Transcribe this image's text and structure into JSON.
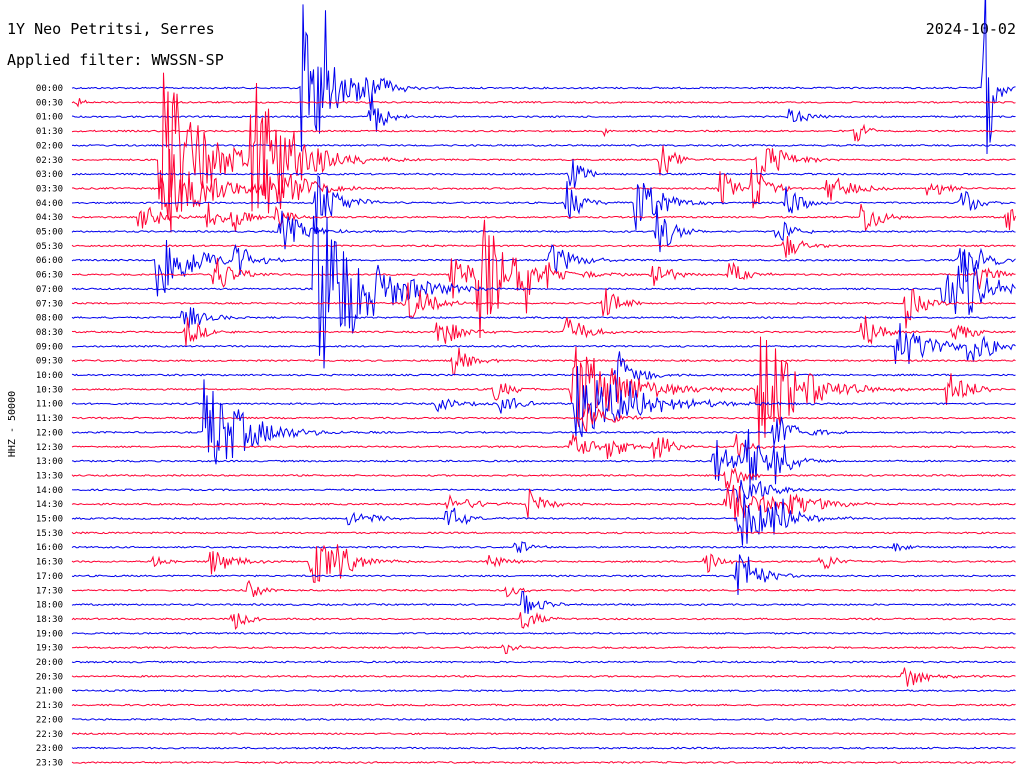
{
  "header": {
    "station": "1Y Neo Petritsi, Serres",
    "date": "2024-10-02",
    "filter": "Applied filter: WWSSN-SP"
  },
  "chart_data": {
    "type": "line",
    "title": "1Y Neo Petritsi, Serres",
    "ylabel": "HHZ - 50000",
    "row_labels": [
      "00:00",
      "00:30",
      "01:00",
      "01:30",
      "02:00",
      "02:30",
      "03:00",
      "03:30",
      "04:00",
      "04:30",
      "05:00",
      "05:30",
      "06:00",
      "06:30",
      "07:00",
      "07:30",
      "08:00",
      "08:30",
      "09:00",
      "09:30",
      "10:00",
      "10:30",
      "11:00",
      "11:30",
      "12:00",
      "12:30",
      "13:00",
      "13:30",
      "14:00",
      "14:30",
      "15:00",
      "15:30",
      "16:00",
      "16:30",
      "17:00",
      "17:30",
      "18:00",
      "18:30",
      "19:00",
      "19:30",
      "20:00",
      "20:30",
      "21:00",
      "21:30",
      "22:00",
      "22:30",
      "23:00",
      "23:30"
    ],
    "colors": [
      "#0000ee",
      "#ff0033"
    ],
    "x_range_minutes": [
      0,
      30
    ],
    "events": [
      {
        "row": 0,
        "minute": 7.9,
        "amp": 120,
        "dur": 0.5
      },
      {
        "row": 0,
        "minute": 7.3,
        "amp": 90,
        "dur": 1.5
      },
      {
        "row": 0,
        "minute": 8.0,
        "amp": 20,
        "dur": 1.2
      },
      {
        "row": 0,
        "minute": 9.0,
        "amp": 25,
        "dur": 1.5
      },
      {
        "row": 0,
        "minute": 9.2,
        "amp": 18,
        "dur": 1.2
      },
      {
        "row": 0,
        "minute": 29.0,
        "amp": 120,
        "dur": 0.5
      },
      {
        "row": 1,
        "minute": 0.2,
        "amp": 8,
        "dur": 0.3
      },
      {
        "row": 2,
        "minute": 9.5,
        "amp": 28,
        "dur": 0.8
      },
      {
        "row": 2,
        "minute": 22.8,
        "amp": 12,
        "dur": 1.0
      },
      {
        "row": 3,
        "minute": 24.9,
        "amp": 14,
        "dur": 0.8
      },
      {
        "row": 3,
        "minute": 16.9,
        "amp": 5,
        "dur": 0.3
      },
      {
        "row": 5,
        "minute": 2.8,
        "amp": 110,
        "dur": 2.5
      },
      {
        "row": 5,
        "minute": 5.7,
        "amp": 90,
        "dur": 2.5
      },
      {
        "row": 5,
        "minute": 21.8,
        "amp": 30,
        "dur": 1.5
      },
      {
        "row": 5,
        "minute": 18.7,
        "amp": 20,
        "dur": 1.0
      },
      {
        "row": 6,
        "minute": 15.8,
        "amp": 25,
        "dur": 0.8
      },
      {
        "row": 7,
        "minute": 2.9,
        "amp": 50,
        "dur": 2.5
      },
      {
        "row": 7,
        "minute": 6.1,
        "amp": 40,
        "dur": 2.0
      },
      {
        "row": 7,
        "minute": 20.6,
        "amp": 20,
        "dur": 1.0
      },
      {
        "row": 7,
        "minute": 21.6,
        "amp": 25,
        "dur": 1.0
      },
      {
        "row": 7,
        "minute": 24.0,
        "amp": 18,
        "dur": 1.5
      },
      {
        "row": 7,
        "minute": 27.2,
        "amp": 15,
        "dur": 1.0
      },
      {
        "row": 8,
        "minute": 7.7,
        "amp": 35,
        "dur": 1.5
      },
      {
        "row": 8,
        "minute": 15.7,
        "amp": 25,
        "dur": 1.0
      },
      {
        "row": 8,
        "minute": 17.9,
        "amp": 35,
        "dur": 1.5
      },
      {
        "row": 8,
        "minute": 18.5,
        "amp": 22,
        "dur": 0.8
      },
      {
        "row": 8,
        "minute": 22.7,
        "amp": 20,
        "dur": 1.0
      },
      {
        "row": 8,
        "minute": 28.2,
        "amp": 20,
        "dur": 1.0
      },
      {
        "row": 9,
        "minute": 2.1,
        "amp": 25,
        "dur": 1.2
      },
      {
        "row": 9,
        "minute": 4.3,
        "amp": 18,
        "dur": 0.8
      },
      {
        "row": 9,
        "minute": 5.1,
        "amp": 22,
        "dur": 0.8
      },
      {
        "row": 9,
        "minute": 6.5,
        "amp": 15,
        "dur": 0.8
      },
      {
        "row": 9,
        "minute": 25.1,
        "amp": 25,
        "dur": 1.0
      },
      {
        "row": 9,
        "minute": 29.7,
        "amp": 18,
        "dur": 0.8
      },
      {
        "row": 10,
        "minute": 6.6,
        "amp": 25,
        "dur": 1.5
      },
      {
        "row": 10,
        "minute": 18.6,
        "amp": 30,
        "dur": 1.0
      },
      {
        "row": 10,
        "minute": 22.3,
        "amp": 20,
        "dur": 1.0
      },
      {
        "row": 11,
        "minute": 22.6,
        "amp": 18,
        "dur": 1.0
      },
      {
        "row": 12,
        "minute": 2.7,
        "amp": 50,
        "dur": 2.0
      },
      {
        "row": 12,
        "minute": 5.2,
        "amp": 22,
        "dur": 1.2
      },
      {
        "row": 12,
        "minute": 15.2,
        "amp": 20,
        "dur": 1.5
      },
      {
        "row": 12,
        "minute": 28.2,
        "amp": 30,
        "dur": 1.5
      },
      {
        "row": 13,
        "minute": 4.5,
        "amp": 25,
        "dur": 1.2
      },
      {
        "row": 13,
        "minute": 12.0,
        "amp": 30,
        "dur": 1.5
      },
      {
        "row": 13,
        "minute": 12.9,
        "amp": 65,
        "dur": 2.5
      },
      {
        "row": 13,
        "minute": 14.4,
        "amp": 30,
        "dur": 1.0
      },
      {
        "row": 13,
        "minute": 18.4,
        "amp": 22,
        "dur": 1.0
      },
      {
        "row": 13,
        "minute": 20.9,
        "amp": 15,
        "dur": 1.0
      },
      {
        "row": 13,
        "minute": 28.8,
        "amp": 18,
        "dur": 1.0
      },
      {
        "row": 14,
        "minute": 7.7,
        "amp": 110,
        "dur": 3.0
      },
      {
        "row": 14,
        "minute": 27.7,
        "amp": 40,
        "dur": 2.0
      },
      {
        "row": 14,
        "minute": 28.3,
        "amp": 30,
        "dur": 1.5
      },
      {
        "row": 15,
        "minute": 10.6,
        "amp": 25,
        "dur": 1.5
      },
      {
        "row": 15,
        "minute": 16.9,
        "amp": 22,
        "dur": 1.0
      },
      {
        "row": 15,
        "minute": 26.5,
        "amp": 25,
        "dur": 1.0
      },
      {
        "row": 16,
        "minute": 3.5,
        "amp": 20,
        "dur": 1.2
      },
      {
        "row": 17,
        "minute": 3.6,
        "amp": 18,
        "dur": 1.0
      },
      {
        "row": 17,
        "minute": 11.6,
        "amp": 22,
        "dur": 1.2
      },
      {
        "row": 17,
        "minute": 15.7,
        "amp": 20,
        "dur": 1.2
      },
      {
        "row": 17,
        "minute": 25.1,
        "amp": 22,
        "dur": 1.2
      },
      {
        "row": 17,
        "minute": 28.0,
        "amp": 18,
        "dur": 1.0
      },
      {
        "row": 18,
        "minute": 26.2,
        "amp": 30,
        "dur": 2.0
      },
      {
        "row": 18,
        "minute": 28.5,
        "amp": 25,
        "dur": 1.5
      },
      {
        "row": 19,
        "minute": 12.1,
        "amp": 18,
        "dur": 1.2
      },
      {
        "row": 20,
        "minute": 17.3,
        "amp": 30,
        "dur": 1.2
      },
      {
        "row": 21,
        "minute": 15.9,
        "amp": 55,
        "dur": 3.0
      },
      {
        "row": 21,
        "minute": 13.4,
        "amp": 15,
        "dur": 1.0
      },
      {
        "row": 21,
        "minute": 21.8,
        "amp": 70,
        "dur": 2.5
      },
      {
        "row": 21,
        "minute": 27.8,
        "amp": 20,
        "dur": 1.5
      },
      {
        "row": 22,
        "minute": 16.0,
        "amp": 45,
        "dur": 3.5
      },
      {
        "row": 22,
        "minute": 11.6,
        "amp": 8,
        "dur": 1.5
      },
      {
        "row": 22,
        "minute": 13.6,
        "amp": 12,
        "dur": 1.2
      },
      {
        "row": 22,
        "minute": 17.4,
        "amp": 20,
        "dur": 1.0
      },
      {
        "row": 23,
        "minute": 16.2,
        "amp": 20,
        "dur": 1.5
      },
      {
        "row": 24,
        "minute": 4.2,
        "amp": 60,
        "dur": 2.5
      },
      {
        "row": 24,
        "minute": 22.3,
        "amp": 22,
        "dur": 1.5
      },
      {
        "row": 25,
        "minute": 15.8,
        "amp": 20,
        "dur": 1.2
      },
      {
        "row": 25,
        "minute": 17.0,
        "amp": 20,
        "dur": 1.0
      },
      {
        "row": 25,
        "minute": 18.5,
        "amp": 18,
        "dur": 1.0
      },
      {
        "row": 25,
        "minute": 21.1,
        "amp": 15,
        "dur": 0.8
      },
      {
        "row": 26,
        "minute": 20.4,
        "amp": 28,
        "dur": 1.5
      },
      {
        "row": 26,
        "minute": 21.4,
        "amp": 35,
        "dur": 1.5
      },
      {
        "row": 26,
        "minute": 22.3,
        "amp": 25,
        "dur": 1.0
      },
      {
        "row": 27,
        "minute": 20.8,
        "amp": 20,
        "dur": 1.0
      },
      {
        "row": 28,
        "minute": 21.2,
        "amp": 25,
        "dur": 1.5
      },
      {
        "row": 29,
        "minute": 11.9,
        "amp": 10,
        "dur": 2.0
      },
      {
        "row": 29,
        "minute": 14.5,
        "amp": 18,
        "dur": 1.0
      },
      {
        "row": 29,
        "minute": 20.8,
        "amp": 30,
        "dur": 2.0
      },
      {
        "row": 29,
        "minute": 22.6,
        "amp": 15,
        "dur": 2.5
      },
      {
        "row": 30,
        "minute": 8.8,
        "amp": 10,
        "dur": 1.5
      },
      {
        "row": 30,
        "minute": 11.9,
        "amp": 18,
        "dur": 1.0
      },
      {
        "row": 30,
        "minute": 21.2,
        "amp": 35,
        "dur": 2.0
      },
      {
        "row": 30,
        "minute": 22.3,
        "amp": 25,
        "dur": 1.5
      },
      {
        "row": 32,
        "minute": 14.1,
        "amp": 12,
        "dur": 0.8
      },
      {
        "row": 32,
        "minute": 26.1,
        "amp": 8,
        "dur": 0.8
      },
      {
        "row": 33,
        "minute": 2.6,
        "amp": 8,
        "dur": 0.8
      },
      {
        "row": 33,
        "minute": 4.4,
        "amp": 15,
        "dur": 1.5
      },
      {
        "row": 33,
        "minute": 7.6,
        "amp": 28,
        "dur": 1.8
      },
      {
        "row": 33,
        "minute": 8.4,
        "amp": 20,
        "dur": 1.0
      },
      {
        "row": 33,
        "minute": 13.2,
        "amp": 10,
        "dur": 1.0
      },
      {
        "row": 33,
        "minute": 20.1,
        "amp": 18,
        "dur": 0.8
      },
      {
        "row": 33,
        "minute": 23.8,
        "amp": 15,
        "dur": 0.8
      },
      {
        "row": 34,
        "minute": 21.1,
        "amp": 40,
        "dur": 1.2
      },
      {
        "row": 35,
        "minute": 5.6,
        "amp": 10,
        "dur": 1.0
      },
      {
        "row": 35,
        "minute": 13.8,
        "amp": 8,
        "dur": 0.8
      },
      {
        "row": 36,
        "minute": 14.3,
        "amp": 15,
        "dur": 1.2
      },
      {
        "row": 37,
        "minute": 5.1,
        "amp": 12,
        "dur": 1.0
      },
      {
        "row": 37,
        "minute": 14.3,
        "amp": 15,
        "dur": 1.0
      },
      {
        "row": 39,
        "minute": 13.7,
        "amp": 8,
        "dur": 0.8
      },
      {
        "row": 41,
        "minute": 26.4,
        "amp": 15,
        "dur": 1.5
      }
    ]
  }
}
